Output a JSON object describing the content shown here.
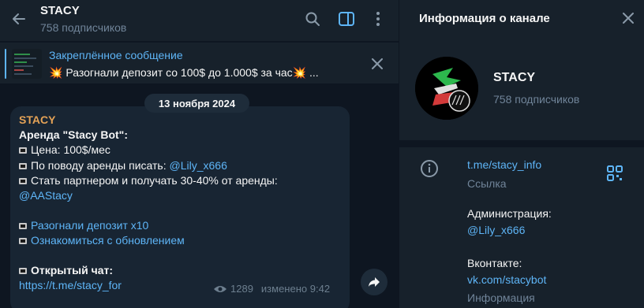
{
  "chat": {
    "title": "STACY",
    "subscribers": "758 подписчиков"
  },
  "pinned": {
    "title": "Закреплённое сообщение",
    "text": "💥 Разогнали депозит со 100$ до 1.000$ за час💥 ..."
  },
  "date_label": "13 ноября 2024",
  "message": {
    "author": "STACY",
    "heading": "Аренда \"Stacy Bot\":",
    "price": "Цена: 100$/мес",
    "rent_contact_text": "По поводу аренды писать: ",
    "rent_contact_link": "@Lily_x666",
    "partner_text": "Стать партнером и получать 30-40% от аренды:",
    "partner_link": "@AAStacy",
    "link1": "Разогнали депозит x10",
    "link2": "Ознакомиться с обновлением",
    "open_chat": "Открытый чат:",
    "open_chat_link": "https://t.me/stacy_for",
    "views": "1289",
    "edited": "изменено 9:42"
  },
  "info": {
    "title": "Информация о канале",
    "name": "STACY",
    "subscribers": "758 подписчиков",
    "link_value": "t.me/stacy_info",
    "link_label": "Ссылка",
    "admin_label": "Администрация:",
    "admin_value": "@Lily_x666",
    "vk_label": "Вконтакте:",
    "vk_value": "vk.com/stacybot",
    "info_label": "Информация"
  },
  "icons": {
    "back": "arrow-left-icon",
    "search": "search-icon",
    "sidebar": "sidebar-toggle-icon",
    "more": "more-vertical-icon",
    "close": "close-icon",
    "views": "eye-icon",
    "share": "share-arrow-icon",
    "info": "info-circle-icon",
    "qr": "qr-code-icon"
  },
  "colors": {
    "accent": "#5eb5f7",
    "author": "#e4a256",
    "background": "#0e1621",
    "panel": "#17212b",
    "bubble": "#182533",
    "muted": "#708499"
  }
}
